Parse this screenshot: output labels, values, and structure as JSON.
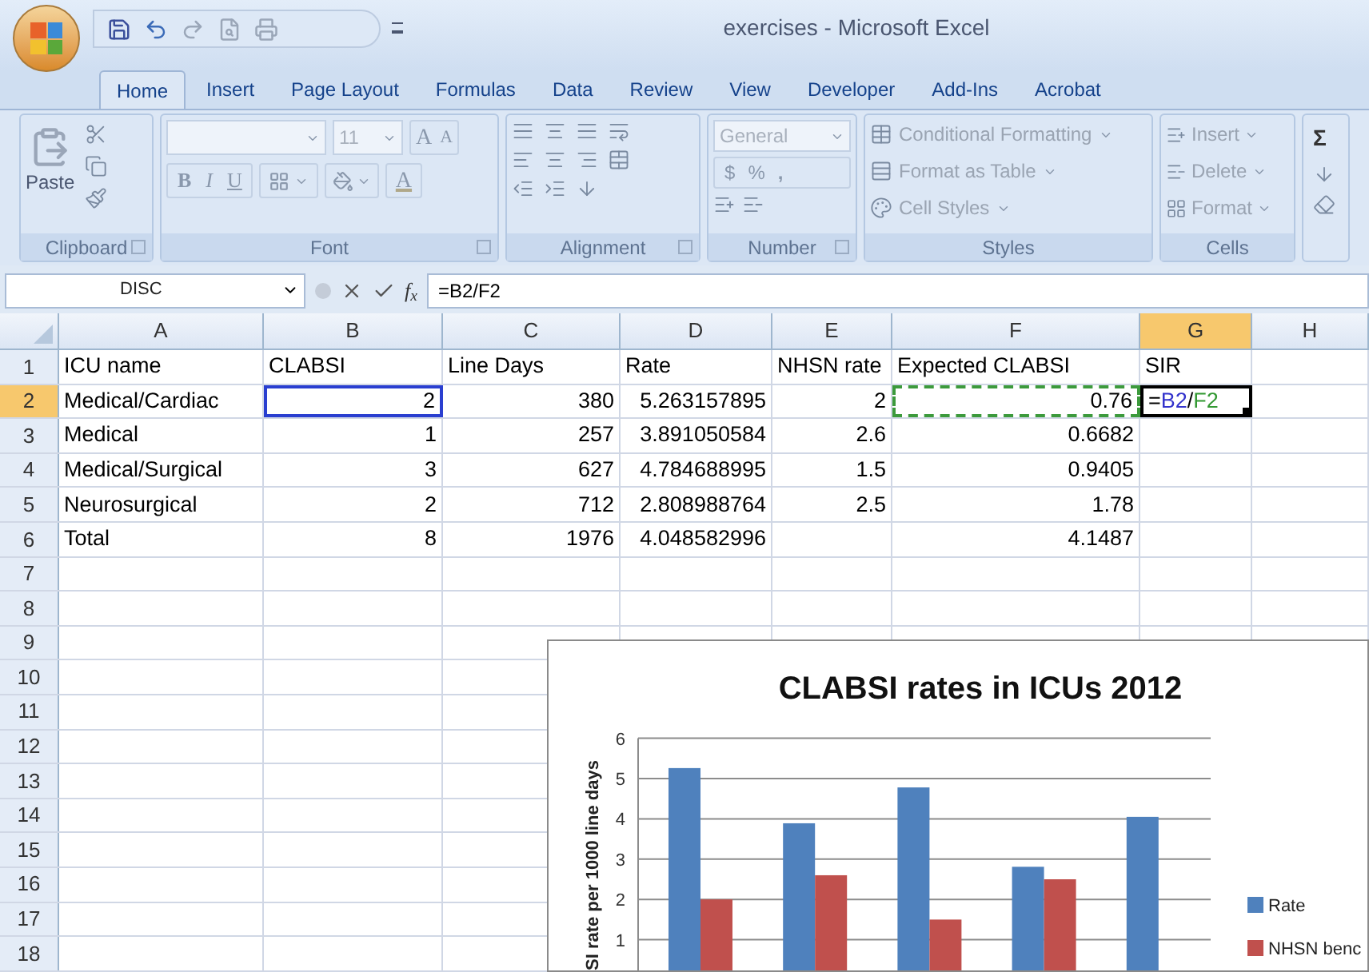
{
  "window": {
    "title": "exercises - Microsoft Excel"
  },
  "tabs": [
    {
      "label": "Home",
      "selected": true
    },
    {
      "label": "Insert",
      "selected": false
    },
    {
      "label": "Page Layout",
      "selected": false
    },
    {
      "label": "Formulas",
      "selected": false
    },
    {
      "label": "Data",
      "selected": false
    },
    {
      "label": "Review",
      "selected": false
    },
    {
      "label": "View",
      "selected": false
    },
    {
      "label": "Developer",
      "selected": false
    },
    {
      "label": "Add-Ins",
      "selected": false
    },
    {
      "label": "Acrobat",
      "selected": false
    }
  ],
  "ribbon": {
    "clipboard": {
      "label": "Clipboard",
      "paste": "Paste"
    },
    "font": {
      "label": "Font",
      "size": "11",
      "grow": "A",
      "shrink": "A",
      "bold": "B",
      "italic": "I",
      "underline": "U",
      "font_color": "A"
    },
    "alignment": {
      "label": "Alignment"
    },
    "number": {
      "label": "Number",
      "format": "General",
      "currency": "$",
      "percent": "%",
      "comma": ","
    },
    "styles": {
      "label": "Styles",
      "items": [
        "Conditional Formatting",
        "Format as Table",
        "Cell Styles"
      ]
    },
    "cells": {
      "label": "Cells",
      "items": [
        "Insert",
        "Delete",
        "Format"
      ]
    },
    "editing": {
      "sum": "Σ"
    }
  },
  "formula_bar": {
    "name_box": "DISC",
    "fx": "f$_{x}$",
    "formula": "=B2/F2"
  },
  "sheet": {
    "columns": [
      {
        "label": "A",
        "selected": false
      },
      {
        "label": "B",
        "selected": false
      },
      {
        "label": "C",
        "selected": false
      },
      {
        "label": "D",
        "selected": false
      },
      {
        "label": "E",
        "selected": false
      },
      {
        "label": "F",
        "selected": false
      },
      {
        "label": "G",
        "selected": true
      },
      {
        "label": "H",
        "selected": false
      }
    ],
    "rows": [
      {
        "header": "1",
        "selected": false,
        "cells": {
          "A": {
            "text": "ICU name",
            "kind": "text"
          },
          "B": {
            "text": "CLABSI",
            "kind": "text"
          },
          "C": {
            "text": "Line Days",
            "kind": "text"
          },
          "D": {
            "text": "Rate",
            "kind": "text"
          },
          "E": {
            "text": "NHSN rate",
            "kind": "text"
          },
          "F": {
            "text": "Expected CLABSI",
            "kind": "text"
          },
          "G": {
            "text": "SIR",
            "kind": "text"
          }
        }
      },
      {
        "header": "2",
        "selected": true,
        "cells": {
          "A": {
            "text": "Medical/Cardiac",
            "kind": "text"
          },
          "B": {
            "text": "2",
            "kind": "number",
            "referenced": true
          },
          "C": {
            "text": "380",
            "kind": "number"
          },
          "D": {
            "text": "5.263157895",
            "kind": "number"
          },
          "E": {
            "text": "2",
            "kind": "number"
          },
          "F": {
            "text": "0.76",
            "kind": "number",
            "copy_marquee": true
          },
          "G": {
            "kind": "editing",
            "active": true,
            "tokens": [
              {
                "text": "=",
                "color": "#000000"
              },
              {
                "text": "B2",
                "color": "#3333cc"
              },
              {
                "text": "/",
                "color": "#000000"
              },
              {
                "text": "F2",
                "color": "#339933"
              }
            ]
          }
        }
      },
      {
        "header": "3",
        "selected": false,
        "cells": {
          "A": {
            "text": "Medical",
            "kind": "text"
          },
          "B": {
            "text": "1",
            "kind": "number"
          },
          "C": {
            "text": "257",
            "kind": "number"
          },
          "D": {
            "text": "3.891050584",
            "kind": "number"
          },
          "E": {
            "text": "2.6",
            "kind": "number"
          },
          "F": {
            "text": "0.6682",
            "kind": "number"
          }
        }
      },
      {
        "header": "4",
        "selected": false,
        "cells": {
          "A": {
            "text": "Medical/Surgical",
            "kind": "text"
          },
          "B": {
            "text": "3",
            "kind": "number"
          },
          "C": {
            "text": "627",
            "kind": "number"
          },
          "D": {
            "text": "4.784688995",
            "kind": "number"
          },
          "E": {
            "text": "1.5",
            "kind": "number"
          },
          "F": {
            "text": "0.9405",
            "kind": "number"
          }
        }
      },
      {
        "header": "5",
        "selected": false,
        "cells": {
          "A": {
            "text": "Neurosurgical",
            "kind": "text"
          },
          "B": {
            "text": "2",
            "kind": "number"
          },
          "C": {
            "text": "712",
            "kind": "number"
          },
          "D": {
            "text": "2.808988764",
            "kind": "number"
          },
          "E": {
            "text": "2.5",
            "kind": "number"
          },
          "F": {
            "text": "1.78",
            "kind": "number"
          }
        }
      },
      {
        "header": "6",
        "selected": false,
        "cells": {
          "A": {
            "text": "Total",
            "kind": "text"
          },
          "B": {
            "text": "8",
            "kind": "number"
          },
          "C": {
            "text": "1976",
            "kind": "number"
          },
          "D": {
            "text": "4.048582996",
            "kind": "number"
          },
          "F": {
            "text": "4.1487",
            "kind": "number"
          }
        }
      },
      {
        "header": "7",
        "selected": false
      },
      {
        "header": "8",
        "selected": false
      },
      {
        "header": "9",
        "selected": false
      },
      {
        "header": "10",
        "selected": false
      },
      {
        "header": "11",
        "selected": false
      },
      {
        "header": "12",
        "selected": false
      },
      {
        "header": "13",
        "selected": false
      },
      {
        "header": "14",
        "selected": false
      },
      {
        "header": "15",
        "selected": false
      },
      {
        "header": "16",
        "selected": false
      },
      {
        "header": "17",
        "selected": false
      },
      {
        "header": "18",
        "selected": false
      }
    ]
  },
  "chart": {
    "chart_data": {
      "type": "bar",
      "title": "CLABSI rates in ICUs 2012",
      "ylabel": "SI rate per 1000 line days",
      "yticks": [
        {
          "value": 1,
          "label": "1"
        },
        {
          "value": 2,
          "label": "2"
        },
        {
          "value": 3,
          "label": "3"
        },
        {
          "value": 4,
          "label": "4"
        },
        {
          "value": 5,
          "label": "5"
        },
        {
          "value": 6,
          "label": "6"
        }
      ],
      "ylim": [
        0,
        6
      ],
      "grid": true,
      "legend": true,
      "series": [
        {
          "name": "Rate",
          "color": "#4f81bd",
          "values": [
            5.26,
            3.89,
            4.78,
            2.81,
            4.05
          ]
        },
        {
          "name": "NHSN benc",
          "color": "#c0504d",
          "values": [
            2,
            2.6,
            1.5,
            2.5,
            null
          ]
        }
      ]
    }
  }
}
